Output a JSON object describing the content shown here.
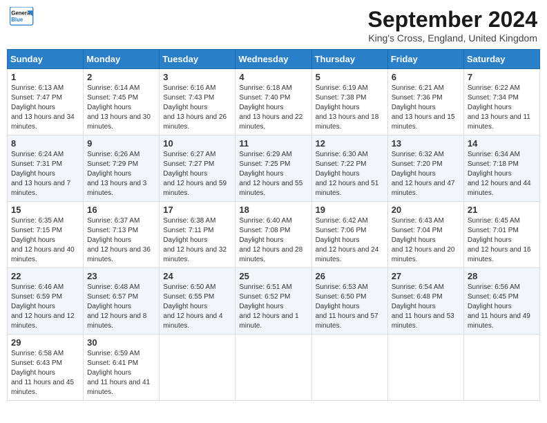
{
  "logo": {
    "line1": "General",
    "line2": "Blue"
  },
  "title": "September 2024",
  "location": "King's Cross, England, United Kingdom",
  "headers": [
    "Sunday",
    "Monday",
    "Tuesday",
    "Wednesday",
    "Thursday",
    "Friday",
    "Saturday"
  ],
  "weeks": [
    [
      {
        "day": "1",
        "sunrise": "6:13 AM",
        "sunset": "7:47 PM",
        "daylight": "13 hours and 34 minutes."
      },
      {
        "day": "2",
        "sunrise": "6:14 AM",
        "sunset": "7:45 PM",
        "daylight": "13 hours and 30 minutes."
      },
      {
        "day": "3",
        "sunrise": "6:16 AM",
        "sunset": "7:43 PM",
        "daylight": "13 hours and 26 minutes."
      },
      {
        "day": "4",
        "sunrise": "6:18 AM",
        "sunset": "7:40 PM",
        "daylight": "13 hours and 22 minutes."
      },
      {
        "day": "5",
        "sunrise": "6:19 AM",
        "sunset": "7:38 PM",
        "daylight": "13 hours and 18 minutes."
      },
      {
        "day": "6",
        "sunrise": "6:21 AM",
        "sunset": "7:36 PM",
        "daylight": "13 hours and 15 minutes."
      },
      {
        "day": "7",
        "sunrise": "6:22 AM",
        "sunset": "7:34 PM",
        "daylight": "13 hours and 11 minutes."
      }
    ],
    [
      {
        "day": "8",
        "sunrise": "6:24 AM",
        "sunset": "7:31 PM",
        "daylight": "13 hours and 7 minutes."
      },
      {
        "day": "9",
        "sunrise": "6:26 AM",
        "sunset": "7:29 PM",
        "daylight": "13 hours and 3 minutes."
      },
      {
        "day": "10",
        "sunrise": "6:27 AM",
        "sunset": "7:27 PM",
        "daylight": "12 hours and 59 minutes."
      },
      {
        "day": "11",
        "sunrise": "6:29 AM",
        "sunset": "7:25 PM",
        "daylight": "12 hours and 55 minutes."
      },
      {
        "day": "12",
        "sunrise": "6:30 AM",
        "sunset": "7:22 PM",
        "daylight": "12 hours and 51 minutes."
      },
      {
        "day": "13",
        "sunrise": "6:32 AM",
        "sunset": "7:20 PM",
        "daylight": "12 hours and 47 minutes."
      },
      {
        "day": "14",
        "sunrise": "6:34 AM",
        "sunset": "7:18 PM",
        "daylight": "12 hours and 44 minutes."
      }
    ],
    [
      {
        "day": "15",
        "sunrise": "6:35 AM",
        "sunset": "7:15 PM",
        "daylight": "12 hours and 40 minutes."
      },
      {
        "day": "16",
        "sunrise": "6:37 AM",
        "sunset": "7:13 PM",
        "daylight": "12 hours and 36 minutes."
      },
      {
        "day": "17",
        "sunrise": "6:38 AM",
        "sunset": "7:11 PM",
        "daylight": "12 hours and 32 minutes."
      },
      {
        "day": "18",
        "sunrise": "6:40 AM",
        "sunset": "7:08 PM",
        "daylight": "12 hours and 28 minutes."
      },
      {
        "day": "19",
        "sunrise": "6:42 AM",
        "sunset": "7:06 PM",
        "daylight": "12 hours and 24 minutes."
      },
      {
        "day": "20",
        "sunrise": "6:43 AM",
        "sunset": "7:04 PM",
        "daylight": "12 hours and 20 minutes."
      },
      {
        "day": "21",
        "sunrise": "6:45 AM",
        "sunset": "7:01 PM",
        "daylight": "12 hours and 16 minutes."
      }
    ],
    [
      {
        "day": "22",
        "sunrise": "6:46 AM",
        "sunset": "6:59 PM",
        "daylight": "12 hours and 12 minutes."
      },
      {
        "day": "23",
        "sunrise": "6:48 AM",
        "sunset": "6:57 PM",
        "daylight": "12 hours and 8 minutes."
      },
      {
        "day": "24",
        "sunrise": "6:50 AM",
        "sunset": "6:55 PM",
        "daylight": "12 hours and 4 minutes."
      },
      {
        "day": "25",
        "sunrise": "6:51 AM",
        "sunset": "6:52 PM",
        "daylight": "12 hours and 1 minute."
      },
      {
        "day": "26",
        "sunrise": "6:53 AM",
        "sunset": "6:50 PM",
        "daylight": "11 hours and 57 minutes."
      },
      {
        "day": "27",
        "sunrise": "6:54 AM",
        "sunset": "6:48 PM",
        "daylight": "11 hours and 53 minutes."
      },
      {
        "day": "28",
        "sunrise": "6:56 AM",
        "sunset": "6:45 PM",
        "daylight": "11 hours and 49 minutes."
      }
    ],
    [
      {
        "day": "29",
        "sunrise": "6:58 AM",
        "sunset": "6:43 PM",
        "daylight": "11 hours and 45 minutes."
      },
      {
        "day": "30",
        "sunrise": "6:59 AM",
        "sunset": "6:41 PM",
        "daylight": "11 hours and 41 minutes."
      },
      null,
      null,
      null,
      null,
      null
    ]
  ]
}
